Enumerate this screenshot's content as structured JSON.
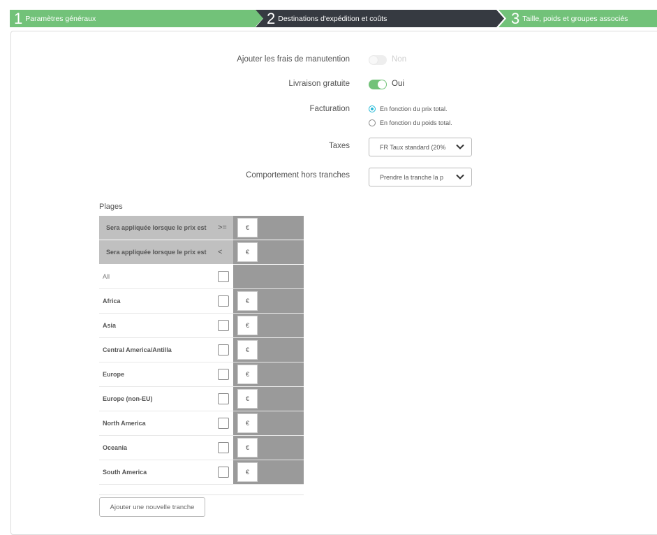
{
  "wizard": {
    "steps": [
      {
        "num": "1",
        "label": "Paramètres généraux"
      },
      {
        "num": "2",
        "label": "Destinations d'expédition et coûts"
      },
      {
        "num": "3",
        "label": "Taille, poids et groupes associés"
      }
    ]
  },
  "form": {
    "handling": {
      "label": "Ajouter les frais de manutention",
      "value": "Non"
    },
    "free_shipping": {
      "label": "Livraison gratuite",
      "value": "Oui"
    },
    "billing": {
      "label": "Facturation",
      "options": [
        "En fonction du prix total.",
        "En fonction du poids total."
      ],
      "selected_index": 0
    },
    "taxes": {
      "label": "Taxes",
      "value": "FR Taux standard (20%"
    },
    "out_of_range": {
      "label": "Comportement hors tranches",
      "value": "Prendre la tranche la p"
    }
  },
  "ranges": {
    "title": "Plages",
    "header_rows": [
      {
        "label": "Sera appliquée lorsque le prix est",
        "op": ">=",
        "currency": "€"
      },
      {
        "label": "Sera appliquée lorsque le prix est",
        "op": "<",
        "currency": "€"
      }
    ],
    "all_label": "All",
    "zones": [
      {
        "name": "Africa",
        "currency": "€"
      },
      {
        "name": "Asia",
        "currency": "€"
      },
      {
        "name": "Central America/Antilla",
        "currency": "€"
      },
      {
        "name": "Europe",
        "currency": "€"
      },
      {
        "name": "Europe (non-EU)",
        "currency": "€"
      },
      {
        "name": "North America",
        "currency": "€"
      },
      {
        "name": "Oceania",
        "currency": "€"
      },
      {
        "name": "South America",
        "currency": "€"
      }
    ],
    "add_button": "Ajouter une nouvelle tranche"
  },
  "colors": {
    "accent_green": "#72c279",
    "dark_step": "#363a41",
    "radio_blue": "#25b9d7",
    "range_grey": "#9a9a9a"
  }
}
